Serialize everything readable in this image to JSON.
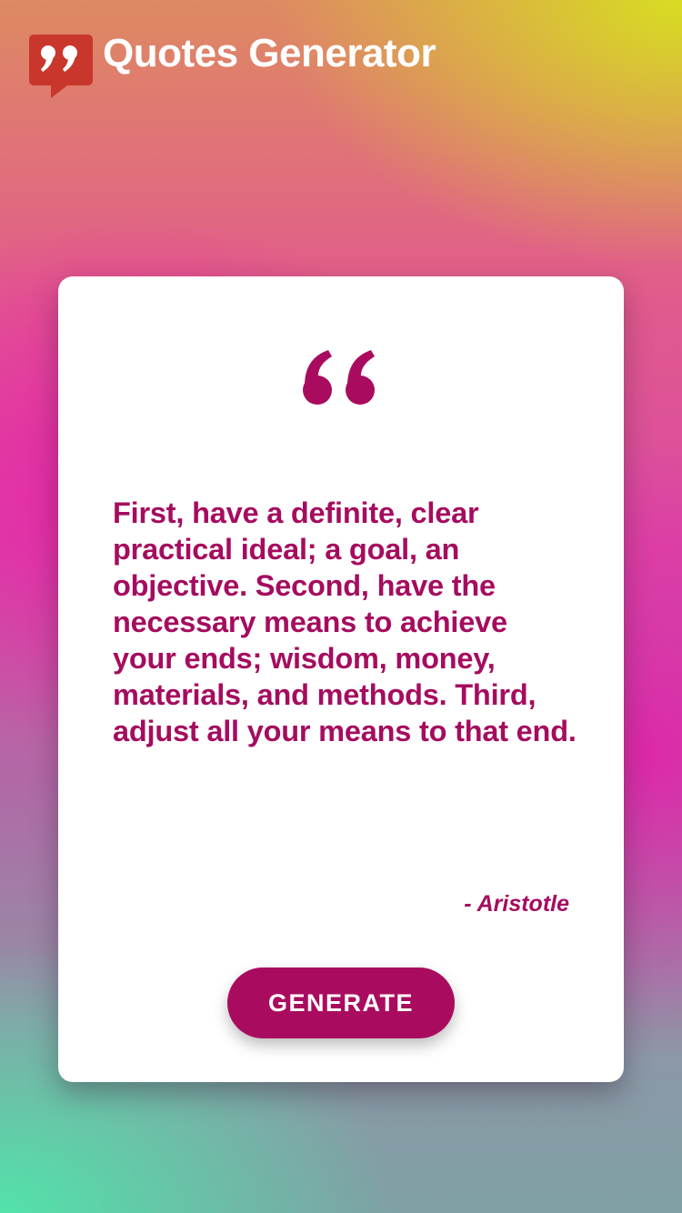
{
  "header": {
    "logo_icon": "speech-bubble-quote-icon",
    "title": "Quotes Generator"
  },
  "quote": {
    "icon": "open-quote-icon",
    "text": "First, have a definite, clear practical ideal; a goal, an objective. Second, have the necessary means to achieve your ends; wisdom, money, materials, and methods. Third, adjust all your means to that end.",
    "author": "- Aristotle"
  },
  "actions": {
    "generate_label": "GENERATE"
  },
  "colors": {
    "accent": "#a90c5f",
    "logo_red": "#c9372c",
    "card_background": "#ffffff"
  }
}
